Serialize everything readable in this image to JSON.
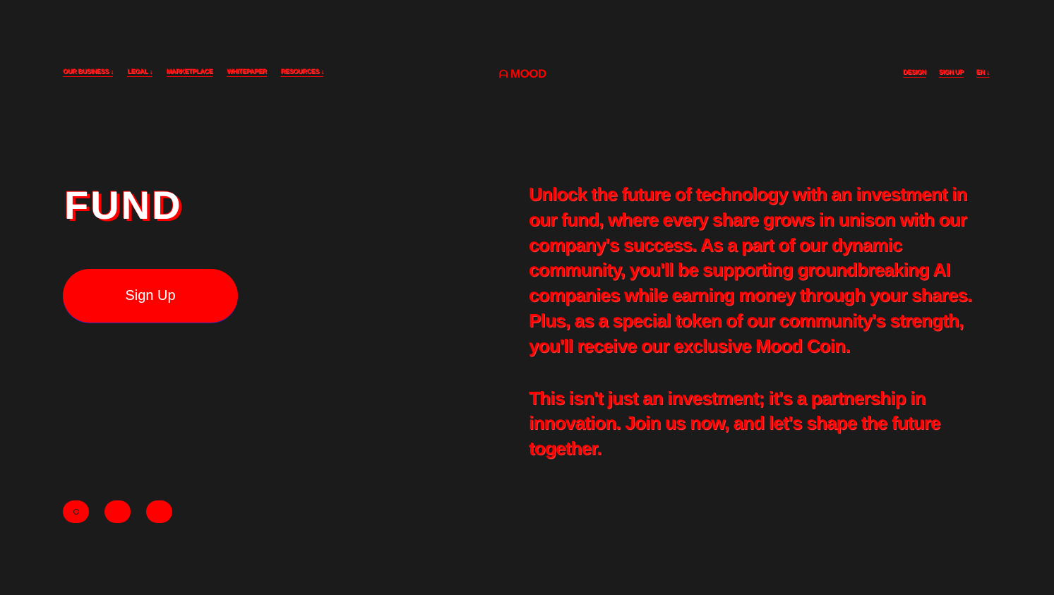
{
  "nav": {
    "links": [
      {
        "label": "OUR BUSINESS ↓"
      },
      {
        "label": "LEGAL ↓"
      },
      {
        "label": "MARKETPLACE"
      },
      {
        "label": "WHITEPAPER"
      },
      {
        "label": "RESOURCES ↓"
      }
    ]
  },
  "logo": {
    "text": "MOOD",
    "icon": "mood-logo-icon"
  },
  "utility": {
    "links": [
      {
        "label": "DESIGN"
      },
      {
        "label": "SIGN UP"
      },
      {
        "label": "EN ↓"
      }
    ]
  },
  "hero": {
    "title": "FUND",
    "signup_label": "Sign Up"
  },
  "description": {
    "paragraph1": "Unlock the future of technology with an investment in our fund, where every share grows in unison with our company's success. As a part of our dynamic community, you'll be supporting groundbreaking AI companies while earning money through your shares. Plus, as a special token of our community's strength, you'll receive our exclusive Mood Coin.",
    "paragraph2": "This isn't just an investment; it's a partnership in innovation. Join us now, and let's shape the future together."
  },
  "social": {
    "icons": [
      "instagram-icon",
      "twitter-icon",
      "discord-icon"
    ]
  },
  "colors": {
    "background": "#1b1b1b",
    "accent": "#ff0000",
    "title_fill": "#ffffff"
  }
}
